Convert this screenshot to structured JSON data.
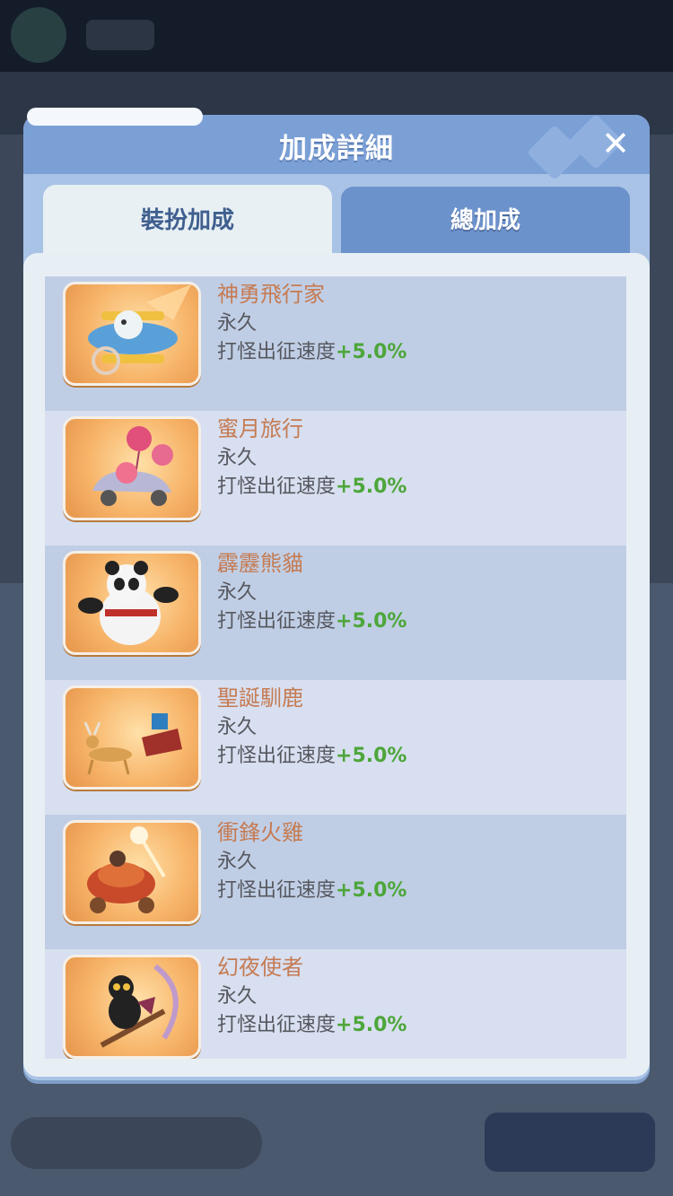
{
  "dialog": {
    "title": "加成詳細",
    "close_icon": "close-icon"
  },
  "tabs": [
    {
      "label": "裝扮加成",
      "active": true
    },
    {
      "label": "總加成",
      "active": false
    }
  ],
  "items": [
    {
      "name": "神勇飛行家",
      "duration": "永久",
      "bonus_label": "打怪出征速度",
      "bonus_value": "+5.0%",
      "icon": "pilot-plane-icon"
    },
    {
      "name": "蜜月旅行",
      "duration": "永久",
      "bonus_label": "打怪出征速度",
      "bonus_value": "+5.0%",
      "icon": "honeymoon-car-icon"
    },
    {
      "name": "霹靂熊貓",
      "duration": "永久",
      "bonus_label": "打怪出征速度",
      "bonus_value": "+5.0%",
      "icon": "kungfu-panda-icon"
    },
    {
      "name": "聖誕馴鹿",
      "duration": "永久",
      "bonus_label": "打怪出征速度",
      "bonus_value": "+5.0%",
      "icon": "reindeer-sleigh-icon"
    },
    {
      "name": "衝鋒火雞",
      "duration": "永久",
      "bonus_label": "打怪出征速度",
      "bonus_value": "+5.0%",
      "icon": "turkey-cart-icon"
    },
    {
      "name": "幻夜使者",
      "duration": "永久",
      "bonus_label": "打怪出征速度",
      "bonus_value": "+5.0%",
      "icon": "night-cat-broom-icon"
    }
  ],
  "colors": {
    "name": "#c57b52",
    "bonus_value": "#4da63a",
    "header": "#7ba0d6"
  }
}
